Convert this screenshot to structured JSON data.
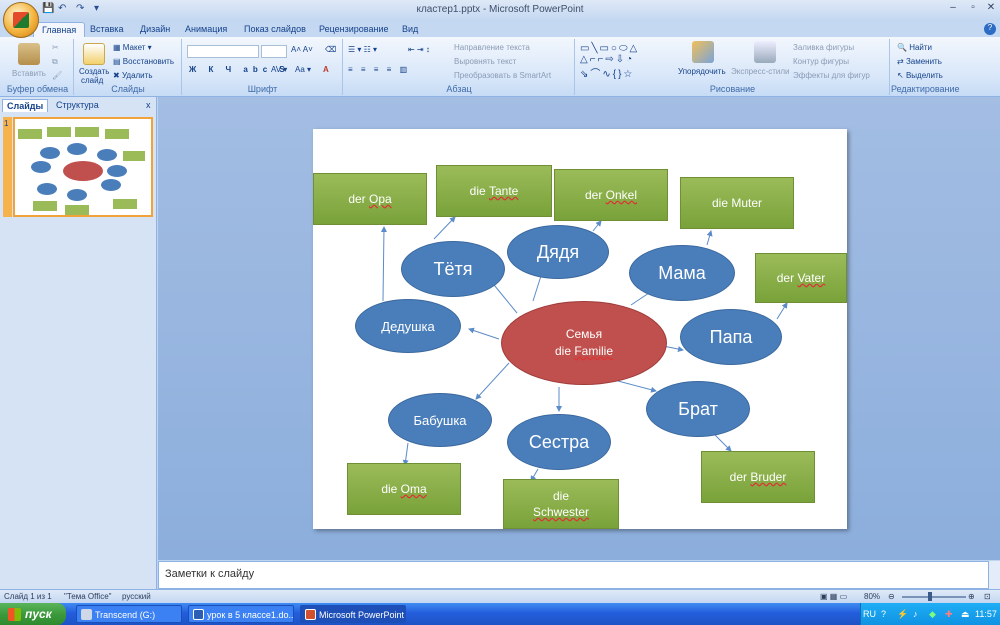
{
  "window": {
    "title": "кластер1.pptx - Microsoft PowerPoint"
  },
  "tabs": [
    "Главная",
    "Вставка",
    "Дизайн",
    "Анимация",
    "Показ слайдов",
    "Рецензирование",
    "Вид"
  ],
  "ribbon": {
    "clipboard": {
      "paste": "Вставить",
      "label": "Буфер обмена"
    },
    "slides": {
      "create1": "Создать",
      "create2": "слайд",
      "layout": "Макет",
      "reset": "Восстановить",
      "delete": "Удалить",
      "label": "Слайды"
    },
    "font": {
      "label": "Шрифт"
    },
    "paragraph": {
      "text_dir": "Направление текста",
      "align_text": "Выровнять текст",
      "smartart": "Преобразовать в SmartArt",
      "label": "Абзац"
    },
    "drawing": {
      "arrange": "Упорядочить",
      "quick_styles": "Экспресс-стили",
      "fill": "Заливка фигуры",
      "outline": "Контур фигуры",
      "effects": "Эффекты для фигур",
      "label": "Рисование"
    },
    "editing": {
      "find": "Найти",
      "replace": "Заменить",
      "select": "Выделить",
      "label": "Редактирование"
    }
  },
  "panel": {
    "tab_slides": "Слайды",
    "tab_outline": "Структура",
    "slide_num": "1"
  },
  "slide": {
    "center": {
      "line1": "Семья",
      "line2_prefix": "die ",
      "line2_word": "Familie"
    },
    "ovals": {
      "tetya": "Тётя",
      "dyadya": "Дядя",
      "mama": "Мама",
      "papa": "Папа",
      "dedushka": "Дедушка",
      "babushka": "Бабушка",
      "sestra": "Сестра",
      "brat": "Брат"
    },
    "boxes": {
      "opa": {
        "prefix": "der ",
        "word": "Opa"
      },
      "tante": {
        "prefix": "die ",
        "word": "Tante"
      },
      "onkel": {
        "prefix": "der ",
        "word": "Onkel"
      },
      "muter": "die Muter",
      "vater": {
        "prefix": "der ",
        "word": "Vater"
      },
      "oma": {
        "prefix": "die ",
        "word": "Oma"
      },
      "schwester1": "die",
      "schwester2": "Schwester",
      "bruder": {
        "prefix": "der ",
        "word": "Bruder"
      }
    },
    "colors": {
      "oval": "#4a7ebb",
      "center": "#c0504d",
      "box": "#9bbb59",
      "arrow": "#5b8bc9"
    }
  },
  "notes": {
    "placeholder": "Заметки к слайду"
  },
  "status": {
    "slide": "Слайд 1 из 1",
    "theme": "\"Тема Office\"",
    "lang": "русский",
    "zoom": "80%"
  },
  "taskbar": {
    "start": "пуск",
    "items": [
      "Transcend (G:)",
      "урок в 5 классе1.do...",
      "Microsoft PowerPoint ..."
    ],
    "lang": "RU",
    "time": "11:57"
  }
}
